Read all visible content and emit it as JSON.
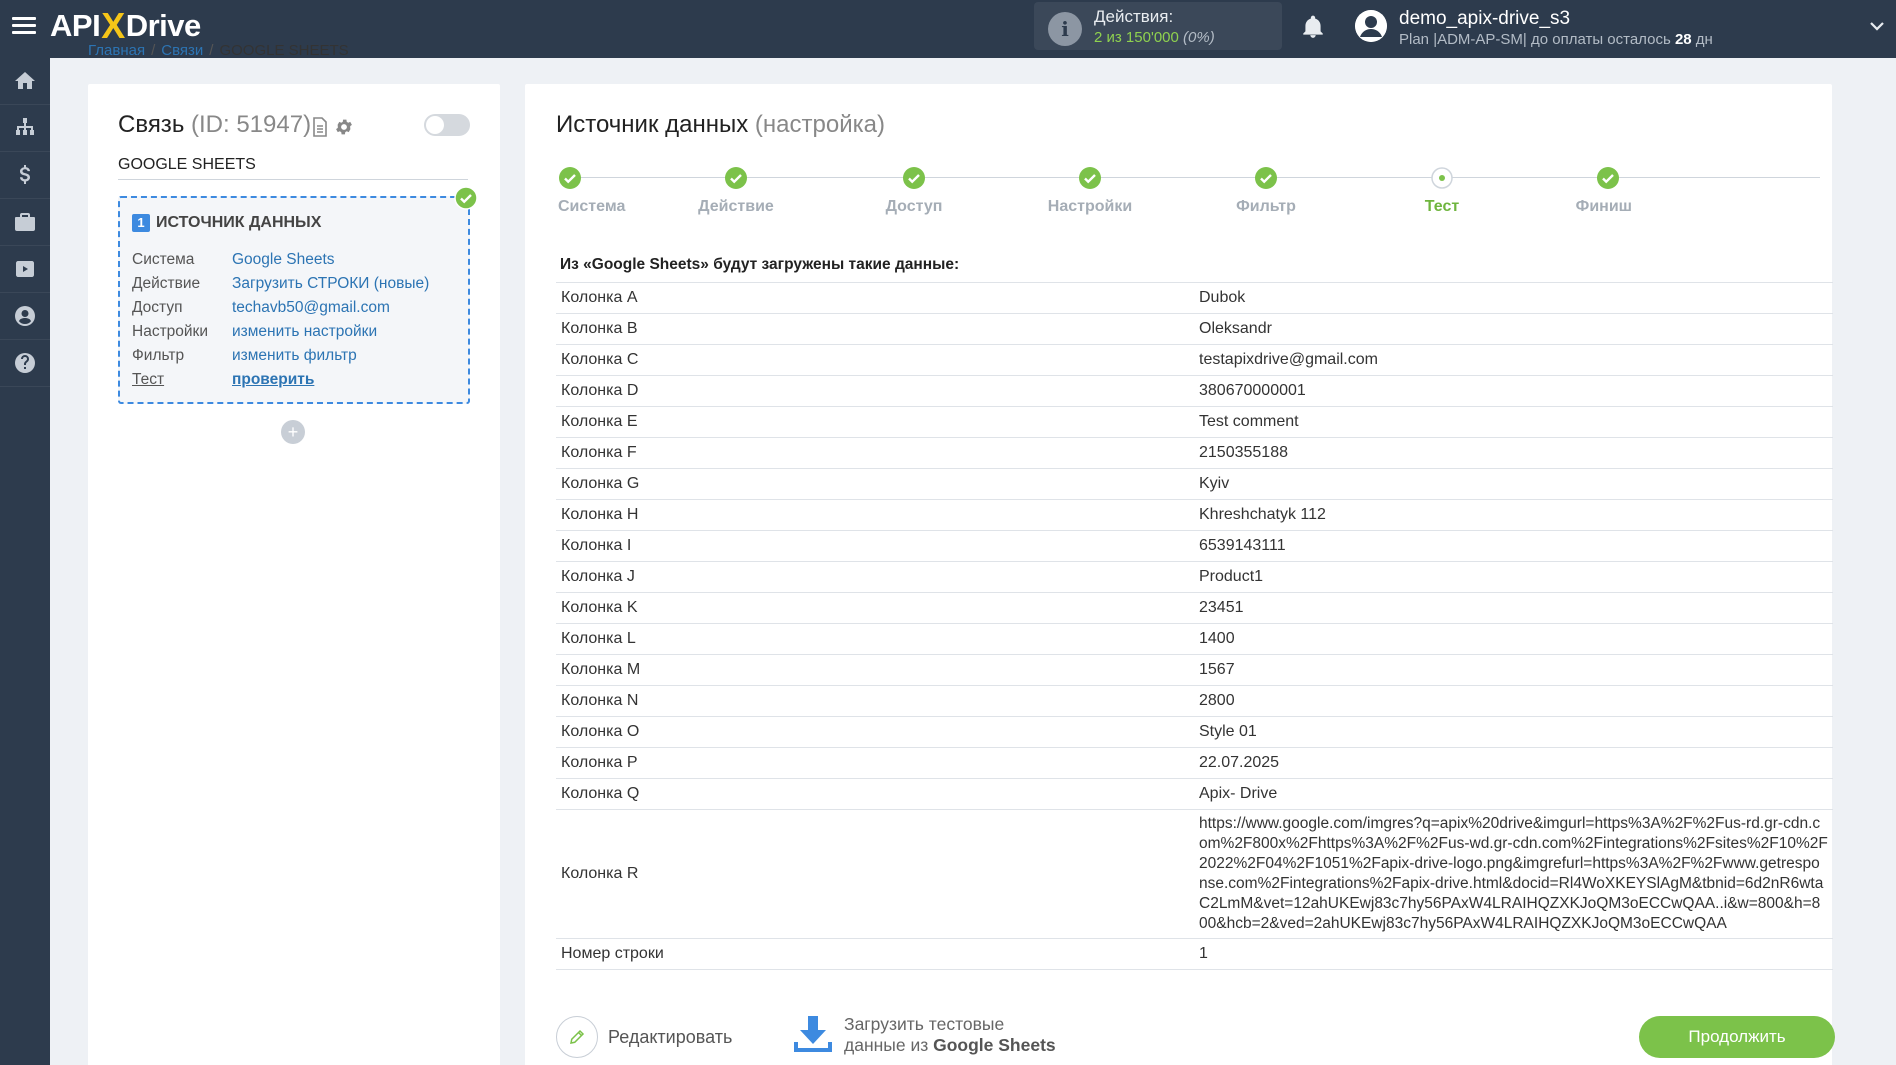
{
  "header": {
    "logo_pre": "API",
    "logo_x": "X",
    "logo_post": "Drive",
    "actions_label": "Действия:",
    "actions_used": "2 из 150'000",
    "actions_pct": "(0%)",
    "user_name": "demo_apix-drive_s3",
    "plan_text": "Plan |ADM-AP-SM| до оплаты осталось ",
    "plan_days": "28",
    "plan_days_unit": " дн"
  },
  "breadcrumb": {
    "home": "Главная",
    "links": "Связи",
    "current": "GOOGLE SHEETS"
  },
  "sidebar": {
    "icons": [
      "home-icon",
      "sitemap-icon",
      "dollar-icon",
      "briefcase-icon",
      "youtube-icon",
      "user-icon",
      "help-icon"
    ]
  },
  "connection": {
    "title": "Связь",
    "id_text": "(ID: 51947)",
    "name": "GOOGLE SHEETS",
    "source_number": "1",
    "source_title": "ИСТОЧНИК ДАННЫХ",
    "rows": [
      {
        "key": "Система",
        "value": "Google Sheets"
      },
      {
        "key": "Действие",
        "value": "Загрузить СТРОКИ (новые)"
      },
      {
        "key": "Доступ",
        "value": "techavb50@gmail.com"
      },
      {
        "key": "Настройки",
        "value": "изменить настройки"
      },
      {
        "key": "Фильтр",
        "value": "изменить фильтр"
      },
      {
        "key": "Тест",
        "value": "проверить"
      }
    ],
    "add_label": "+"
  },
  "main": {
    "title": "Источник данных",
    "subtitle": "(настройка)",
    "steps": [
      "Система",
      "Действие",
      "Доступ",
      "Настройки",
      "Фильтр",
      "Тест",
      "Финиш"
    ],
    "active_step": 5,
    "data_heading": "Из «Google Sheets» будут загружены такие данные:",
    "rows": [
      {
        "key": "Колонка A",
        "value": "Dubok"
      },
      {
        "key": "Колонка B",
        "value": "Oleksandr"
      },
      {
        "key": "Колонка C",
        "value": "testapixdrive@gmail.com"
      },
      {
        "key": "Колонка D",
        "value": "380670000001"
      },
      {
        "key": "Колонка E",
        "value": "Test comment"
      },
      {
        "key": "Колонка F",
        "value": "2150355188"
      },
      {
        "key": "Колонка G",
        "value": "Kyiv"
      },
      {
        "key": "Колонка H",
        "value": "Khreshchatyk 112"
      },
      {
        "key": "Колонка I",
        "value": "6539143111"
      },
      {
        "key": "Колонка J",
        "value": "Product1"
      },
      {
        "key": "Колонка K",
        "value": "23451"
      },
      {
        "key": "Колонка L",
        "value": "1400"
      },
      {
        "key": "Колонка M",
        "value": "1567"
      },
      {
        "key": "Колонка N",
        "value": "2800"
      },
      {
        "key": "Колонка O",
        "value": "Style 01"
      },
      {
        "key": "Колонка P",
        "value": "22.07.2025"
      },
      {
        "key": "Колонка Q",
        "value": "Apix- Drive"
      },
      {
        "key": "Колонка R",
        "value": "https://www.google.com/imgres?q=apix%20drive&imgurl=https%3A%2F%2Fus-rd.gr-cdn.com%2F800x%2Fhttps%3A%2F%2Fus-wd.gr-cdn.com%2Fintegrations%2Fsites%2F10%2F2022%2F04%2F1051%2Fapix-drive-logo.png&imgrefurl=https%3A%2F%2Fwww.getresponse.com%2Fintegrations%2Fapix-drive.html&docid=Rl4WoXKEYSlAgM&tbnid=6d2nR6wtaC2LmM&vet=12ahUKEwj83c7hy56PAxW4LRAIHQZXKJoQM3oECCwQAA..i&w=800&h=800&hcb=2&ved=2ahUKEwj83c7hy56PAxW4LRAIHQZXKJoQM3oECCwQAA"
      },
      {
        "key": "Номер строки",
        "value": "1"
      }
    ],
    "edit_label": "Редактировать",
    "load_label_1": "Загрузить тестовые",
    "load_label_2": "данные из ",
    "load_label_3": "Google Sheets",
    "continue_label": "Продолжить"
  },
  "colors": {
    "dark": "#2d3b4d",
    "green": "#7cc24a",
    "blue": "#3d8ae0",
    "link": "#2c74b3"
  }
}
